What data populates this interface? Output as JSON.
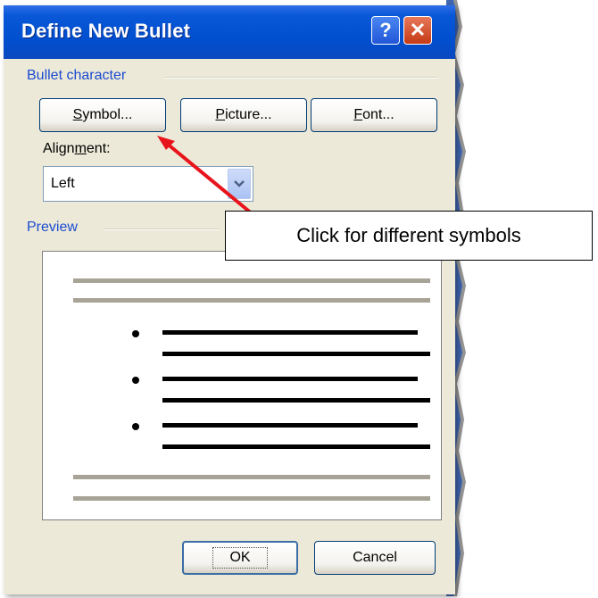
{
  "dialog": {
    "title": "Define New Bullet",
    "help_label": "?",
    "close_label": "✕"
  },
  "bullet_character": {
    "group_label": "Bullet character",
    "symbol_button": {
      "pre": "",
      "accel": "S",
      "post": "ymbol..."
    },
    "picture_button": {
      "pre": "",
      "accel": "P",
      "post": "icture..."
    },
    "font_button": {
      "pre": "",
      "accel": "F",
      "post": "ont..."
    },
    "alignment_label": {
      "pre": "Align",
      "accel": "m",
      "post": "ent:"
    },
    "alignment_value": "Left"
  },
  "preview": {
    "group_label": "Preview",
    "bullet_count": 3
  },
  "footer": {
    "ok_label": "OK",
    "cancel_label": "Cancel"
  },
  "annotation": {
    "callout_text": "Click for different symbols",
    "arrow_color": "#e8141b"
  },
  "colors": {
    "titlebar": "#0050d0",
    "dialog_bg": "#ece9d8",
    "group_label": "#1a4bd1",
    "preview_gray": "#a7a396"
  }
}
